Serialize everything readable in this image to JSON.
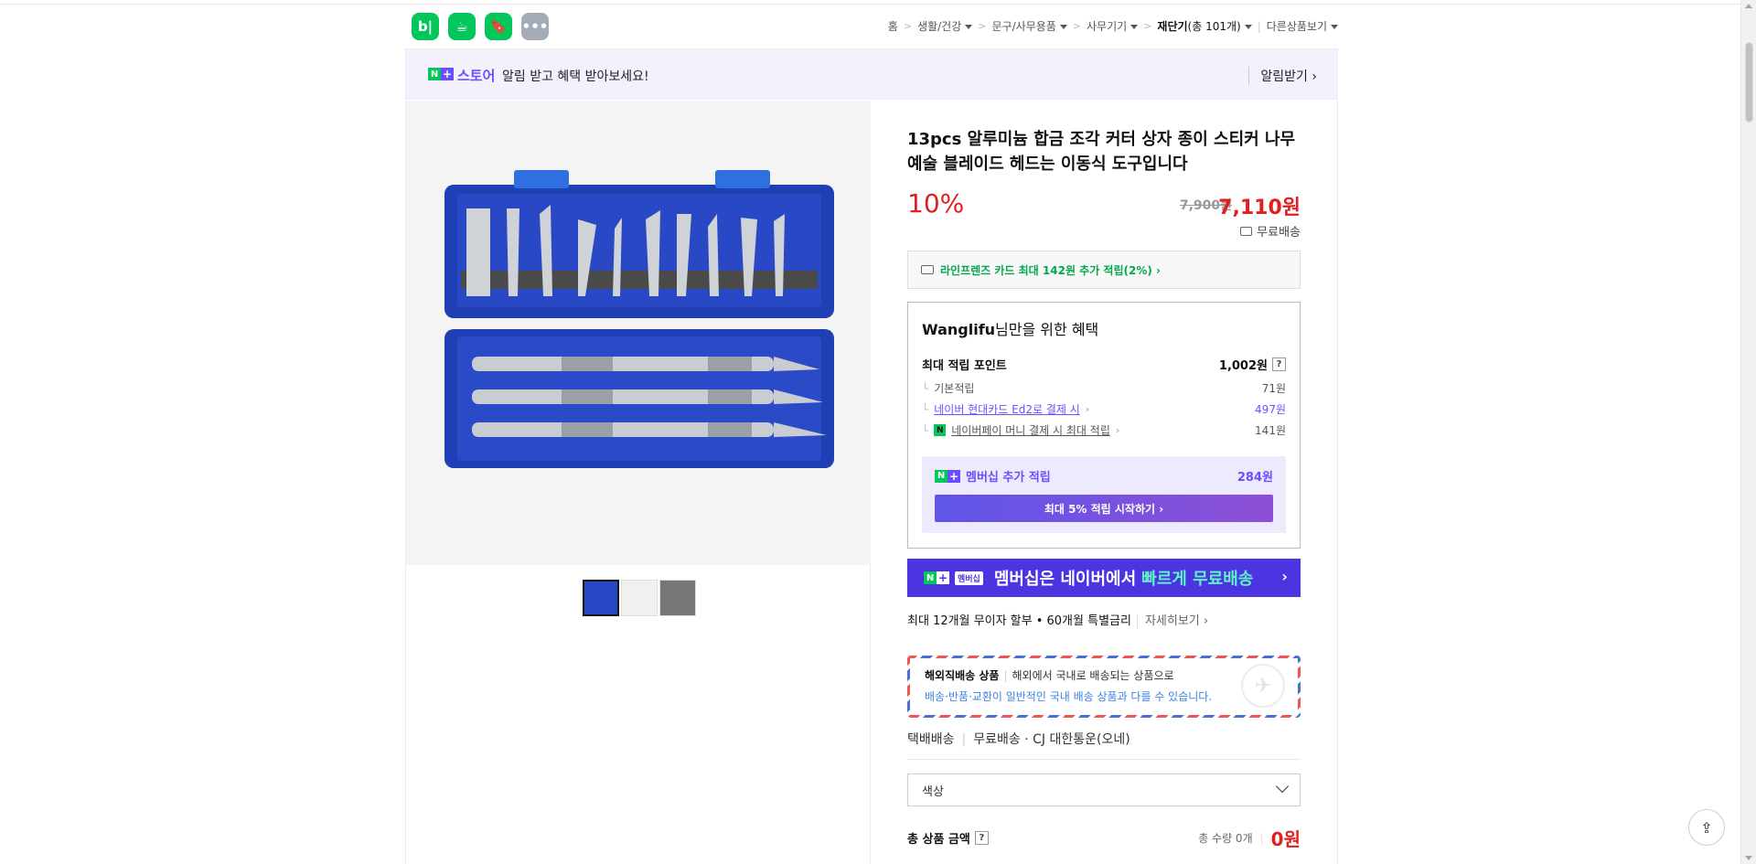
{
  "header": {
    "app_icons": [
      {
        "name": "blog-icon",
        "label": "b|"
      },
      {
        "name": "cafe-icon",
        "label": "☕"
      },
      {
        "name": "bookmark-icon",
        "label": "🔖"
      },
      {
        "name": "more-apps-icon",
        "label": "•••"
      }
    ],
    "breadcrumb": {
      "home": "홈",
      "cat1": "생활/건강",
      "cat2": "문구/사무용품",
      "cat3": "사무기기",
      "current": "재단기",
      "current_count": "(총 101개)",
      "other": "다른상품보기"
    }
  },
  "alert": {
    "store_label": "스토어",
    "message": "알림 받고 혜택 받아보세요!",
    "button": "알림받기 ›"
  },
  "product": {
    "title": "13pcs 알루미늄 합금 조각 커터 상자 종이 스티커 나무 예술 블레이드 헤드는 이동식 도구입니다",
    "discount": "10%",
    "original_price": "7,900원",
    "price": "7,110원",
    "shipping": "무료배송",
    "card_benefit": "라인프렌즈 카드 최대 142원 추가 적립(2%) ›"
  },
  "benefit": {
    "user": "Wanglifu",
    "heading_suffix": "님만을 위한 혜택",
    "max_points_label": "최대 적립 포인트",
    "max_points_value": "1,002원",
    "rows": [
      {
        "label": "기본적립",
        "value": "71원"
      },
      {
        "label": "네이버 현대카드 Ed2로 결제 시",
        "value": "497원"
      },
      {
        "label": "네이버페이 머니 결제 시 최대 적립",
        "value": "141원"
      }
    ],
    "membership_label": "멤버십 추가 적립",
    "membership_value": "284원",
    "start_button": "최대 5% 적립 시작하기 ›"
  },
  "banner": {
    "mini": "멤버십",
    "text_a": "멤버십은 네이버에서",
    "text_b": "빠르게 무료배송",
    "chevron": "›"
  },
  "installment": {
    "text": "최대 12개월 무이자 할부 • 60개월 특별금리",
    "more": "자세히보기 ›"
  },
  "overseas": {
    "title": "해외직배송 상품",
    "desc": "해외에서 국내로 배송되는 상품으로",
    "note": "배송·반품·교환이 일반적인 국내 배송 상품과 다를 수 있습니다."
  },
  "delivery": {
    "type": "택배배송",
    "fee": "무료배송",
    "carrier": "· CJ 대한통운(오네)"
  },
  "option": {
    "placeholder": "색상"
  },
  "total": {
    "label": "총 상품 금액",
    "qty": "총 수량 0개",
    "amount": "0원"
  },
  "colors": {
    "naver_green": "#03c75a",
    "price_red": "#e02020",
    "membership_purple": "#6b4eff"
  }
}
